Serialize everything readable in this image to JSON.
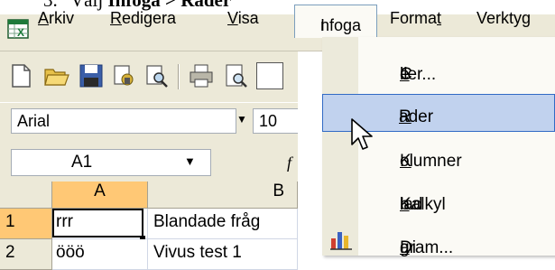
{
  "instruction": {
    "number": "3.",
    "prefix": "Välj",
    "path": "Infoga > Rader"
  },
  "menubar": {
    "items": [
      {
        "label_pre": "",
        "label_u": "A",
        "label_post": "rkiv"
      },
      {
        "label_pre": "",
        "label_u": "R",
        "label_post": "edigera"
      },
      {
        "label_pre": "",
        "label_u": "V",
        "label_post": "isa"
      },
      {
        "label_pre": "",
        "label_u": "I",
        "label_post": "nfoga"
      },
      {
        "label_pre": "Forma",
        "label_u": "t",
        "label_post": ""
      },
      {
        "label_pre": "Verktyg",
        "label_u": "",
        "label_post": ""
      }
    ]
  },
  "formatting": {
    "font": "Arial",
    "size": "10"
  },
  "namebox": {
    "value": "A1",
    "fx": "f"
  },
  "grid": {
    "columns": [
      "A",
      "B"
    ],
    "rows": [
      "1",
      "2"
    ],
    "cells": {
      "a1": "rrr",
      "b1": "Blandade fråg",
      "a2": "ööö",
      "b2": "Vivus test 1"
    }
  },
  "dropdown": {
    "items": [
      {
        "pre": "C",
        "u": "e",
        "post": "ller..."
      },
      {
        "pre": "",
        "u": "R",
        "post": "ader"
      },
      {
        "pre": "",
        "u": "K",
        "post": "olumner"
      },
      {
        "pre": "Kalkyl",
        "u": "b",
        "post": "lad"
      },
      {
        "pre": "Di",
        "u": "a",
        "post": "gram..."
      }
    ],
    "highlighted": "Rader"
  },
  "colors": {
    "menu_bg": "#ece9d8",
    "highlight": "#c1d2ee",
    "highlight_border": "#316ac5"
  }
}
